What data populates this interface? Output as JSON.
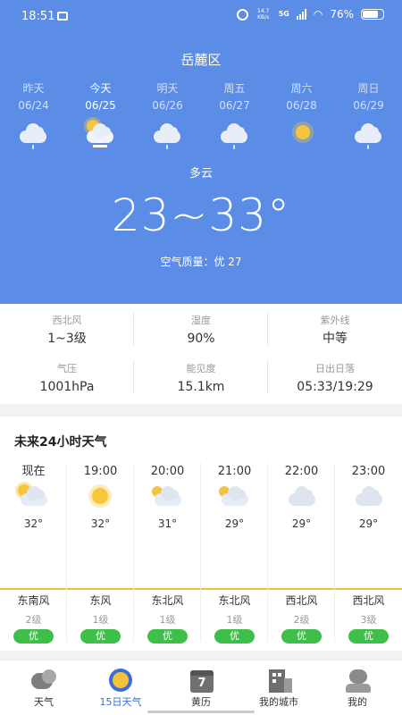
{
  "status": {
    "time": "18:51",
    "speed_top": "14.7",
    "speed_bottom": "KB/s",
    "network": "5G",
    "battery": "76%",
    "battery_level": 0.76
  },
  "location": "岳麓区",
  "days": [
    {
      "name": "昨天",
      "date": "06/24",
      "icon": "cloud-rain-icon"
    },
    {
      "name": "今天",
      "date": "06/25",
      "icon": "partly-cloudy-icon"
    },
    {
      "name": "明天",
      "date": "06/26",
      "icon": "cloud-rain-icon"
    },
    {
      "name": "周五",
      "date": "06/27",
      "icon": "cloud-rain-icon"
    },
    {
      "name": "周六",
      "date": "06/28",
      "icon": "sunny-icon"
    },
    {
      "name": "周日",
      "date": "06/29",
      "icon": "cloud-rain-icon"
    }
  ],
  "current": {
    "condition": "多云",
    "temp_range": "23~33°",
    "aqi": "空气质量：优 27"
  },
  "details": [
    {
      "label": "西北风",
      "value": "1~3级"
    },
    {
      "label": "湿度",
      "value": "90%"
    },
    {
      "label": "紫外线",
      "value": "中等"
    },
    {
      "label": "气压",
      "value": "1001hPa"
    },
    {
      "label": "能见度",
      "value": "15.1km"
    },
    {
      "label": "日出日落",
      "value": "05:33/19:29"
    }
  ],
  "hourly_title": "未来24小时天气",
  "hourly": [
    {
      "time": "现在",
      "icon": "partly-cloudy-icon",
      "temp": "32°",
      "wind": "东南风",
      "level": "2级",
      "aqi": "优"
    },
    {
      "time": "19:00",
      "icon": "sunny-icon",
      "temp": "32°",
      "wind": "东风",
      "level": "1级",
      "aqi": "优"
    },
    {
      "time": "20:00",
      "icon": "cloudy-night-icon",
      "temp": "31°",
      "wind": "东北风",
      "level": "1级",
      "aqi": "优"
    },
    {
      "time": "21:00",
      "icon": "cloudy-night-icon",
      "temp": "29°",
      "wind": "东北风",
      "level": "1级",
      "aqi": "优"
    },
    {
      "time": "22:00",
      "icon": "cloud-icon",
      "temp": "29°",
      "wind": "西北风",
      "level": "2级",
      "aqi": "优"
    },
    {
      "time": "23:00",
      "icon": "cloud-icon",
      "temp": "29°",
      "wind": "西北风",
      "level": "3级",
      "aqi": "优"
    }
  ],
  "nav": [
    {
      "label": "天气",
      "icon": "weather-tab-icon"
    },
    {
      "label": "15日天气",
      "icon": "sun-tab-icon"
    },
    {
      "label": "黄历",
      "icon": "calendar-tab-icon",
      "badge": "7"
    },
    {
      "label": "我的城市",
      "icon": "city-tab-icon"
    },
    {
      "label": "我的",
      "icon": "profile-tab-icon"
    }
  ],
  "colors": {
    "hero": "#5b8de6",
    "accent": "#3a6fd8",
    "badge": "#3fbf4a",
    "tempLine": "#e8c23a"
  }
}
